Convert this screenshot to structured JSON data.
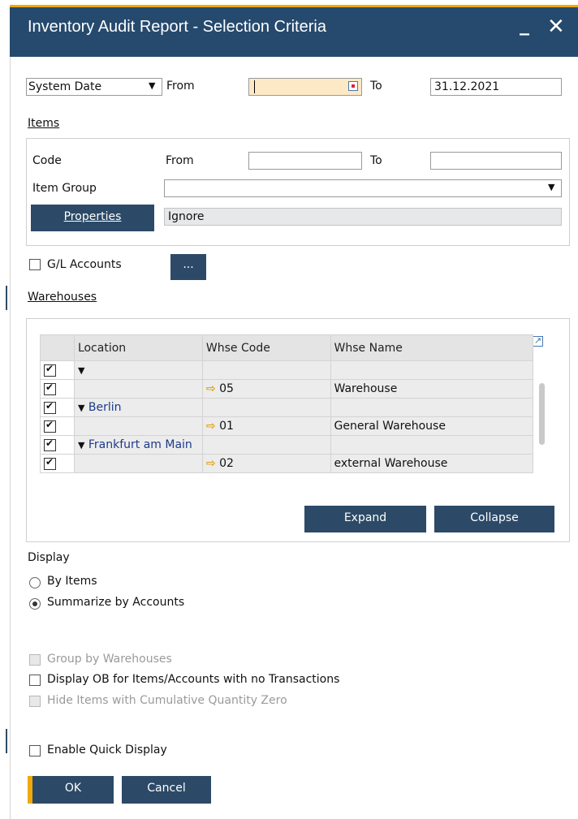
{
  "window": {
    "title": "Inventory Audit Report - Selection Criteria",
    "minimize": "_",
    "close": "✕"
  },
  "date_row": {
    "type_value": "System Date",
    "from_label": "From",
    "from_value": "",
    "to_label": "To",
    "to_value": "31.12.2021"
  },
  "items": {
    "section_label": "Items",
    "code_label": "Code",
    "from_label": "From",
    "to_label": "To",
    "code_from": "",
    "code_to": "",
    "group_label": "Item Group",
    "group_value": "",
    "properties_button": "Properties",
    "properties_value": "Ignore"
  },
  "gl_accounts": {
    "label": "G/L Accounts",
    "checked": false,
    "button": "..."
  },
  "warehouses": {
    "section_label": "Warehouses",
    "columns": [
      "Location",
      "Whse Code",
      "Whse Name"
    ],
    "rows": [
      {
        "checked": true,
        "location": "",
        "group": true,
        "code": "",
        "name": ""
      },
      {
        "checked": true,
        "location": "",
        "group": false,
        "code": "05",
        "name": "Warehouse"
      },
      {
        "checked": true,
        "location": "Berlin",
        "group": true,
        "code": "",
        "name": ""
      },
      {
        "checked": true,
        "location": "",
        "group": false,
        "code": "01",
        "name": "General Warehouse"
      },
      {
        "checked": true,
        "location": "Frankfurt am Main",
        "group": true,
        "code": "",
        "name": ""
      },
      {
        "checked": true,
        "location": "",
        "group": false,
        "code": "02",
        "name": "external Warehouse"
      }
    ],
    "expand_button": "Expand",
    "collapse_button": "Collapse"
  },
  "display": {
    "label": "Display",
    "by_items": "By Items",
    "summarize": "Summarize by Accounts",
    "selected": "summarize"
  },
  "options": {
    "group_by_whse": "Group by Warehouses",
    "display_ob": "Display OB for Items/Accounts with no Transactions",
    "hide_zero": "Hide Items with Cumulative Quantity Zero",
    "quick_display": "Enable Quick Display"
  },
  "footer": {
    "ok": "OK",
    "cancel": "Cancel"
  },
  "colors": {
    "accent": "#f0a80b",
    "title_bar": "#264a6e",
    "button": "#2c4a67",
    "location_text": "#1c3a8a"
  }
}
